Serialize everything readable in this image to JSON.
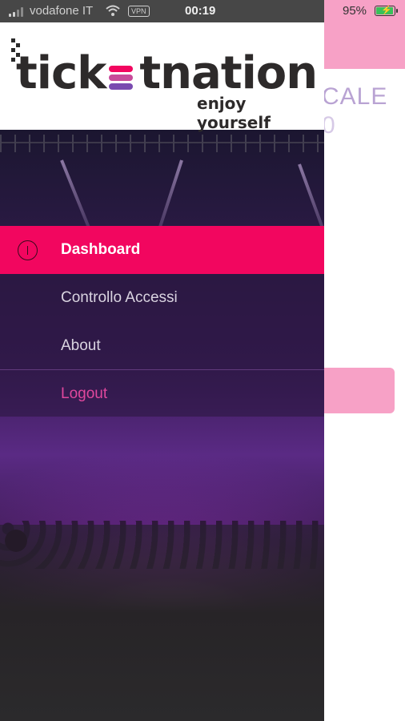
{
  "status_bar": {
    "carrier": "vodafone IT",
    "vpn": "VPN",
    "time": "00:19",
    "battery_percent": "95%",
    "battery_level": 0.95
  },
  "underlay": {
    "title_fragment": "CALE",
    "title_fragment_2": "0"
  },
  "drawer": {
    "logo": {
      "text_before": "tick",
      "text_after": "tnation",
      "tagline": "enjoy yourself"
    },
    "menu": [
      {
        "label": "Dashboard",
        "icon": "info-icon",
        "active": true
      },
      {
        "label": "Controllo Accessi",
        "active": false
      },
      {
        "label": "About",
        "active": false
      },
      {
        "label": "Logout",
        "active": false
      }
    ]
  },
  "colors": {
    "accent": "#f2065f",
    "logout": "#e0479d",
    "underlay_pink": "#f7a1c6"
  }
}
